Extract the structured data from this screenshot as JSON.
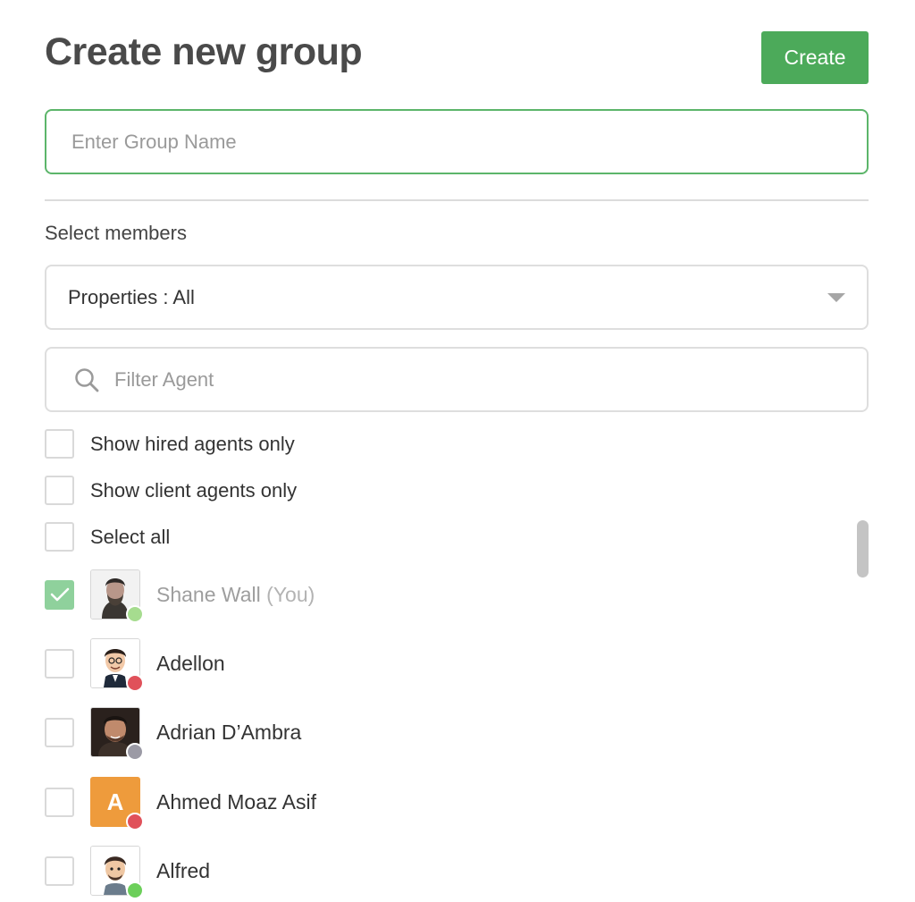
{
  "header": {
    "title": "Create new group",
    "create_label": "Create"
  },
  "group_name": {
    "value": "",
    "placeholder": "Enter Group Name"
  },
  "members_section": {
    "label": "Select members"
  },
  "properties_dropdown": {
    "selected": "Properties : All"
  },
  "filter": {
    "value": "",
    "placeholder": "Filter Agent"
  },
  "options": [
    {
      "label": "Show hired agents only",
      "checked": false
    },
    {
      "label": "Show client agents only",
      "checked": false
    },
    {
      "label": "Select all",
      "checked": false
    }
  ],
  "members": [
    {
      "name": "Shane Wall",
      "suffix": "(You)",
      "checked": true,
      "status": "online",
      "avatar": "photo"
    },
    {
      "name": "Adellon",
      "suffix": "",
      "checked": false,
      "status": "busy",
      "avatar": "photo"
    },
    {
      "name": "Adrian D’Ambra",
      "suffix": "",
      "checked": false,
      "status": "offline",
      "avatar": "photo"
    },
    {
      "name": "Ahmed Moaz Asif",
      "suffix": "",
      "checked": false,
      "status": "busy",
      "avatar": "A"
    },
    {
      "name": "Alfred",
      "suffix": "",
      "checked": false,
      "status": "online",
      "avatar": "photo"
    }
  ],
  "colors": {
    "accent": "#4caa5a",
    "checked": "#8fd19c",
    "status_online": "#6ccf5a",
    "status_online_light": "#a6dc8f",
    "status_busy": "#e0515a",
    "status_offline": "#9b9aa5",
    "letter_avatar": "#ee9b3c"
  }
}
